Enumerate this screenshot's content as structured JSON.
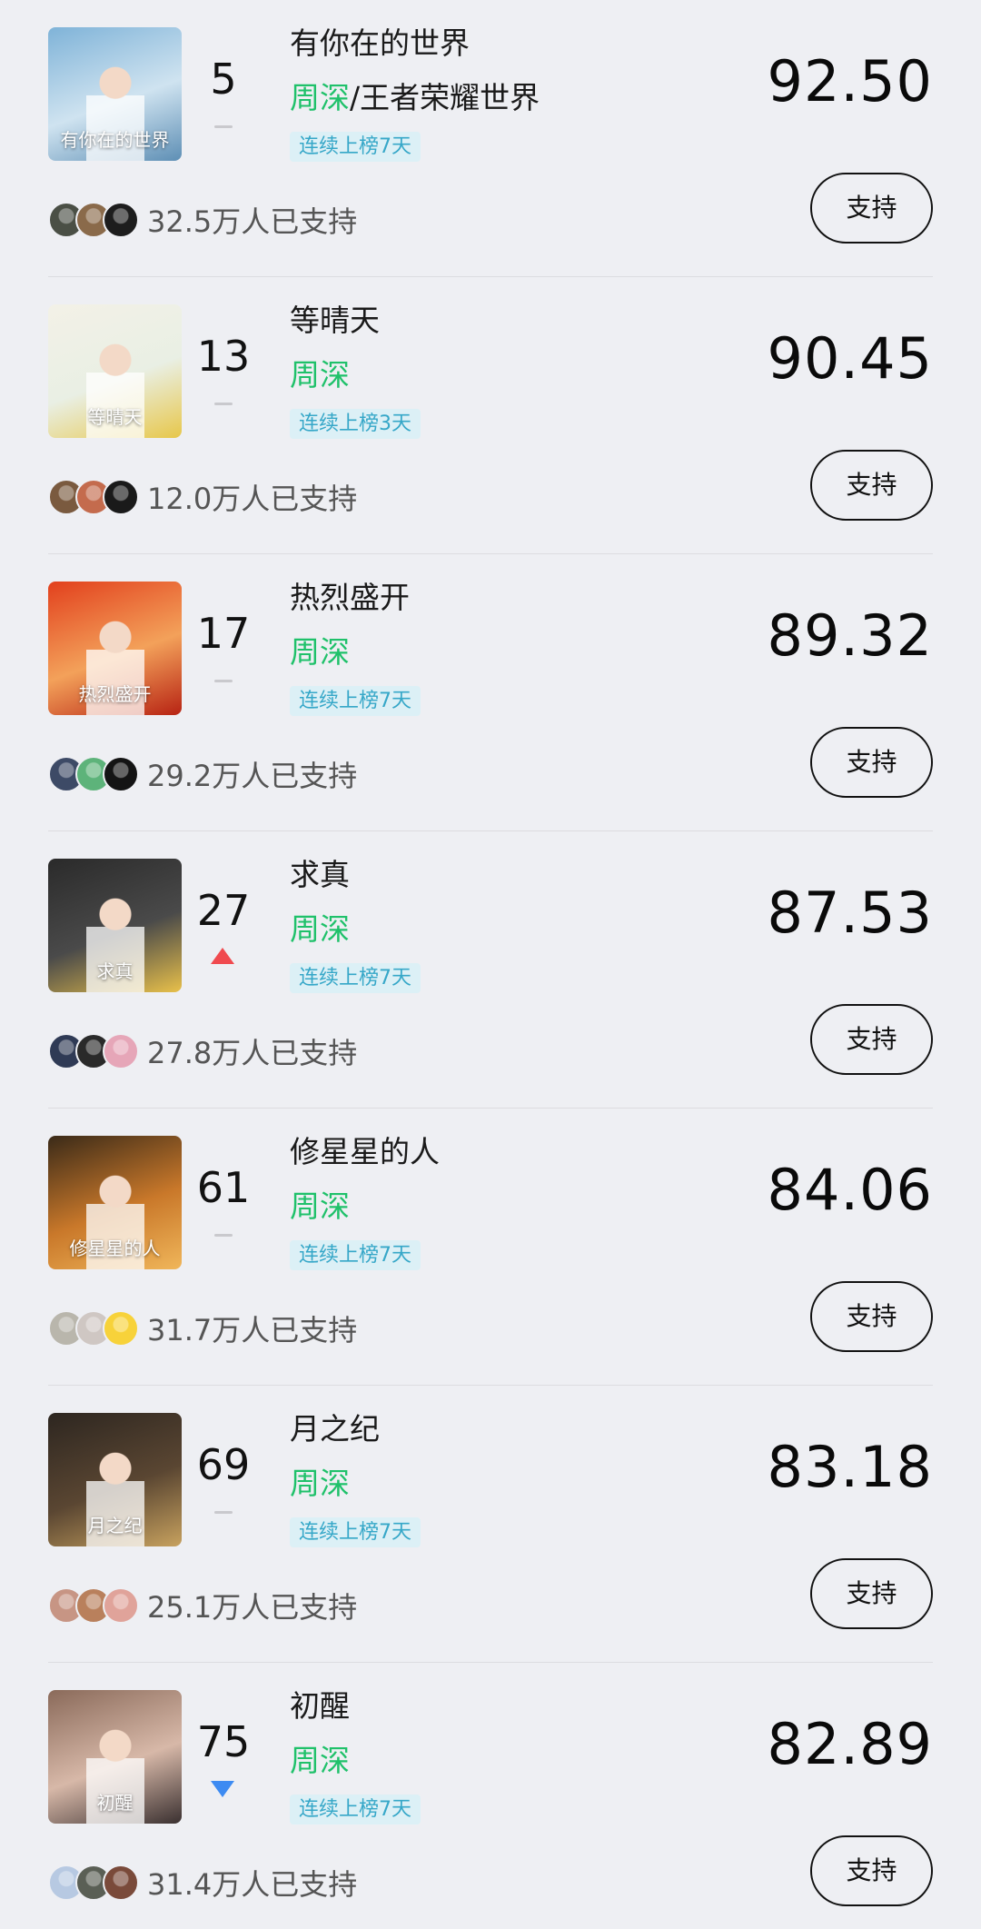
{
  "support_button_label": "支持",
  "colors": {
    "artist_green": "#1fc16a",
    "streak_text": "#36a7c8",
    "streak_bg": "#dcf0f6",
    "trend_up": "#f04a4f",
    "trend_down": "#3d8bf2",
    "trend_flat": "#c9c9cd"
  },
  "entries": [
    {
      "rank": "5",
      "trend": "flat",
      "title": "有你在的世界",
      "artist": "周深",
      "artist_suffix": "/王者荣耀世界",
      "streak": "连续上榜7天",
      "score": "92.50",
      "supporters": "32.5万人已支持",
      "cover_text": "有你在的世界",
      "cover_colors": [
        "#7fb3d8",
        "#cfe3f0",
        "#5e8fb5"
      ],
      "avatar_colors": [
        "#4a4f45",
        "#8a6a4a",
        "#1d1d1d"
      ]
    },
    {
      "rank": "13",
      "trend": "flat",
      "title": "等晴天",
      "artist": "周深",
      "artist_suffix": "",
      "streak": "连续上榜3天",
      "score": "90.45",
      "supporters": "12.0万人已支持",
      "cover_text": "等晴天",
      "cover_colors": [
        "#f3f1e7",
        "#e9efe4",
        "#e7c74a"
      ],
      "avatar_colors": [
        "#7a5a3f",
        "#c46b4d",
        "#1a1a1a"
      ]
    },
    {
      "rank": "17",
      "trend": "flat",
      "title": "热烈盛开",
      "artist": "周深",
      "artist_suffix": "",
      "streak": "连续上榜7天",
      "score": "89.32",
      "supporters": "29.2万人已支持",
      "cover_text": "热烈盛开",
      "cover_colors": [
        "#e2401d",
        "#f3a15a",
        "#b72313"
      ],
      "avatar_colors": [
        "#3d4a66",
        "#5db37a",
        "#141414"
      ]
    },
    {
      "rank": "27",
      "trend": "up",
      "title": "求真",
      "artist": "周深",
      "artist_suffix": "",
      "streak": "连续上榜7天",
      "score": "87.53",
      "supporters": "27.8万人已支持",
      "cover_text": "求真",
      "cover_colors": [
        "#2a2a2a",
        "#4a4a4a",
        "#e8c04a"
      ],
      "avatar_colors": [
        "#2f3a55",
        "#2a2a2a",
        "#e6a6b8"
      ]
    },
    {
      "rank": "61",
      "trend": "flat",
      "title": "修星星的人",
      "artist": "周深",
      "artist_suffix": "",
      "streak": "连续上榜7天",
      "score": "84.06",
      "supporters": "31.7万人已支持",
      "cover_text": "修星星的人",
      "cover_colors": [
        "#3a2a18",
        "#c9782a",
        "#f0b65a"
      ],
      "avatar_colors": [
        "#b9b6ac",
        "#cfc7c3",
        "#f7d23a"
      ]
    },
    {
      "rank": "69",
      "trend": "flat",
      "title": "月之纪",
      "artist": "周深",
      "artist_suffix": "",
      "streak": "连续上榜7天",
      "score": "83.18",
      "supporters": "25.1万人已支持",
      "cover_text": "月之纪",
      "cover_colors": [
        "#2d2620",
        "#5a4632",
        "#c7a15e"
      ],
      "avatar_colors": [
        "#c79584",
        "#b9805c",
        "#e0a39a"
      ]
    },
    {
      "rank": "75",
      "trend": "down",
      "title": "初醒",
      "artist": "周深",
      "artist_suffix": "",
      "streak": "连续上榜7天",
      "score": "82.89",
      "supporters": "31.4万人已支持",
      "cover_text": "初醒",
      "cover_colors": [
        "#8a6a5a",
        "#d7b8a8",
        "#3a3030"
      ],
      "avatar_colors": [
        "#b7c9e2",
        "#5a5f55",
        "#7a4a3a"
      ]
    }
  ]
}
